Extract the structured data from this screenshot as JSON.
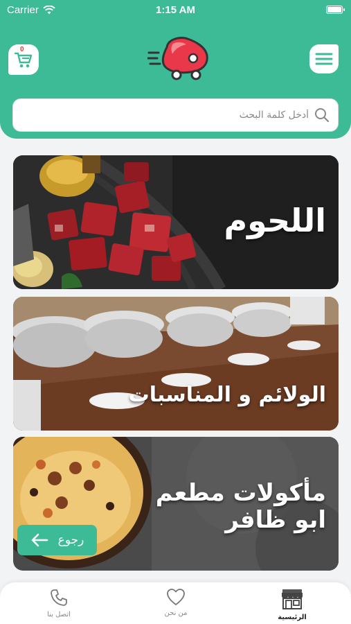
{
  "status_bar": {
    "carrier": "Carrier",
    "time": "1:15 AM",
    "wifi_icon": "wifi-icon",
    "battery_icon": "battery-icon"
  },
  "header": {
    "cart_badge": "0",
    "cart_icon": "cart-icon",
    "menu_icon": "hamburger-menu-icon",
    "logo_icon": "meat-truck-logo-icon",
    "accent_color": "#3dbb97"
  },
  "search": {
    "placeholder": "أدخل كلمة البحث",
    "value": "",
    "icon": "search-icon"
  },
  "categories": [
    {
      "title": "اللحوم"
    },
    {
      "title": "الولائم و المناسبات"
    },
    {
      "title_line1": "مأكولات مطعم",
      "title_line2": "ابو ظافر"
    }
  ],
  "back_button": {
    "label": "رجوع",
    "icon": "arrow-left-icon"
  },
  "tabs": [
    {
      "label": "اتصل بنا",
      "icon": "phone-icon"
    },
    {
      "label": "من نحن",
      "icon": "heart-icon"
    },
    {
      "label": "الرئيسية",
      "icon": "store-icon"
    }
  ]
}
